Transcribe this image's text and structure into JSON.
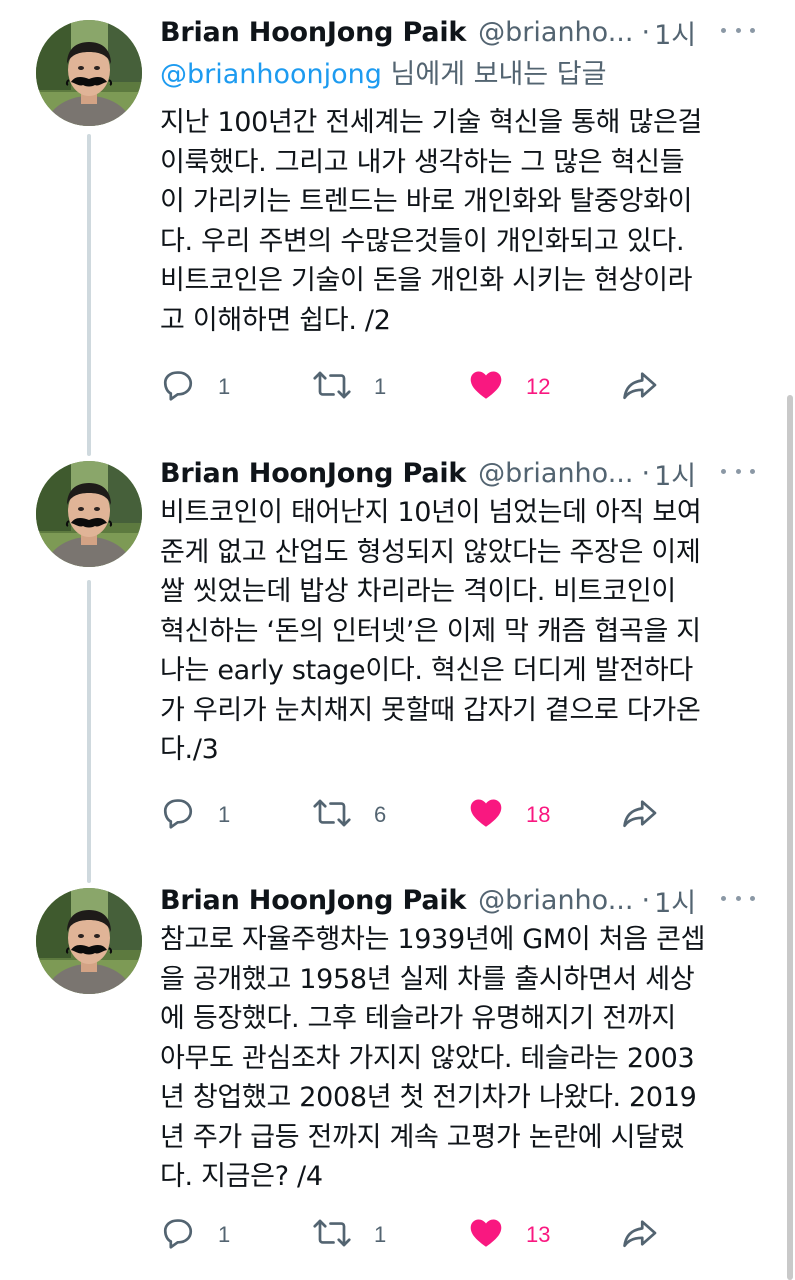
{
  "tweets": [
    {
      "author": {
        "name": "Brian HoonJong Paik",
        "handle": "@brianho...",
        "time": "1시"
      },
      "reply_to": {
        "mention": "@brianhoonjong",
        "suffix": " 님에게 보내는 답글"
      },
      "lines": [
        "지난 100년간 전세계는 기술 혁신을 통해 많은걸",
        "이룩했다. 그리고 내가 생각하는 그 많은 혁신들",
        "이 가리키는 트렌드는 바로 개인화와 탈중앙화이",
        "다. 우리 주변의 수많은것들이 개인화되고 있다.",
        "비트코인은 기술이 돈을 개인화 시키는 현상이라",
        "고 이해하면 쉽다. /2"
      ],
      "stats": {
        "replies": "1",
        "retweets": "1",
        "likes": "12"
      }
    },
    {
      "author": {
        "name": "Brian HoonJong Paik",
        "handle": "@brianho...",
        "time": "1시"
      },
      "lines": [
        "비트코인이 태어난지 10년이 넘었는데 아직 보여",
        "준게 없고 산업도 형성되지 않았다는 주장은 이제",
        "쌀 씻었는데 밥상 차리라는 격이다. 비트코인이",
        "혁신하는 ‘돈의 인터넷’은 이제 막 캐즘 협곡을 지",
        "나는 early stage이다. 혁신은 더디게 발전하다",
        "가 우리가 눈치채지 못할때 갑자기 곁으로 다가온",
        "다./3"
      ],
      "stats": {
        "replies": "1",
        "retweets": "6",
        "likes": "18"
      }
    },
    {
      "author": {
        "name": "Brian HoonJong Paik",
        "handle": "@brianho...",
        "time": "1시"
      },
      "lines": [
        "참고로 자율주행차는 1939년에 GM이 처음 콘셉",
        "을 공개했고 1958년 실제 차를 출시하면서 세상",
        "에 등장했다. 그후 테슬라가 유명해지기 전까지",
        "아무도 관심조차 가지지 않았다. 테슬라는 2003",
        "년 창업했고 2008년 첫 전기차가 나왔다. 2019",
        "년 주가 급등 전까지 계속 고평가 논란에 시달렸",
        "다. 지금은? /4"
      ],
      "stats": {
        "replies": "1",
        "retweets": "1",
        "likes": "13"
      }
    }
  ],
  "icons": {
    "reply": "reply-icon",
    "retweet": "retweet-icon",
    "like": "heart-icon",
    "share": "share-icon",
    "more": "more-icon"
  },
  "colors": {
    "like": "#f91880",
    "mention": "#1d9bf0",
    "secondary": "#536471",
    "thread_line": "#cfd9de"
  }
}
